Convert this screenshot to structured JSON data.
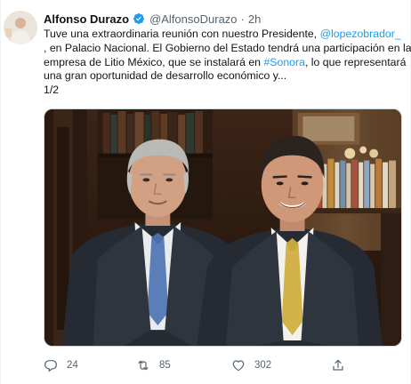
{
  "tweet": {
    "author": {
      "display_name": "Alfonso Durazo",
      "handle": "@AlfonsoDurazo",
      "separator": "·",
      "time": "2h",
      "verified": true,
      "avatar_icon": "profile-photo"
    },
    "text_lines": [
      [
        {
          "t": "Tuve una extraordinaria reunión con nuestro Presidente, "
        },
        {
          "t": "@lopezobrador_",
          "link": true
        },
        {
          "t": ""
        }
      ],
      [
        {
          "t": ", en Palacio Nacional. El Gobierno del Estado tendrá una participación en la"
        }
      ],
      [
        {
          "t": "empresa de Litio México, que se instalará en "
        },
        {
          "t": "#Sonora",
          "link": true
        },
        {
          "t": ", lo que representará"
        }
      ],
      [
        {
          "t": "una gran oportunidad de desarrollo económico y..."
        }
      ],
      [
        {
          "t": "1/2"
        }
      ]
    ],
    "media": {
      "kind": "photo",
      "description_icon": "photo"
    },
    "actions": {
      "reply_count": "24",
      "retweet_count": "85",
      "like_count": "302",
      "reply_icon": "reply-icon",
      "retweet_icon": "retweet-icon",
      "like_icon": "heart-icon",
      "share_icon": "share-icon"
    },
    "colors": {
      "link": "#1d9bf0",
      "verified": "#1d9bf0",
      "secondary_text": "#536471",
      "primary_text": "#0f1419"
    }
  }
}
